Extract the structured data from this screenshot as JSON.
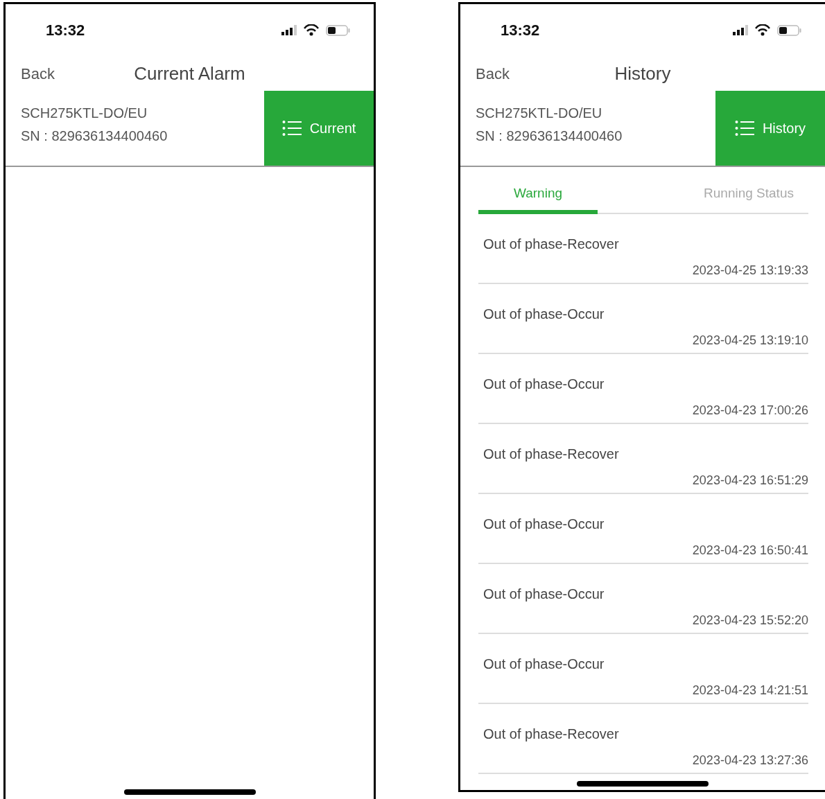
{
  "screens": [
    {
      "status_bar": {
        "time": "13:32"
      },
      "nav": {
        "back": "Back",
        "title": "Current Alarm"
      },
      "device": {
        "model": "SCH275KTL-DO/EU",
        "sn": "SN : 829636134400460"
      },
      "mode_button": {
        "label": "Current"
      }
    },
    {
      "status_bar": {
        "time": "13:32"
      },
      "nav": {
        "back": "Back",
        "title": "History"
      },
      "device": {
        "model": "SCH275KTL-DO/EU",
        "sn": "SN : 829636134400460"
      },
      "mode_button": {
        "label": "History"
      },
      "tabs": [
        {
          "label": "Warning",
          "selected": true
        },
        {
          "label": "Running Status",
          "selected": false
        }
      ],
      "entries": [
        {
          "event": "Out of phase-Recover",
          "time": "2023-04-25 13:19:33"
        },
        {
          "event": "Out of phase-Occur",
          "time": "2023-04-25 13:19:10"
        },
        {
          "event": "Out of phase-Occur",
          "time": "2023-04-23 17:00:26"
        },
        {
          "event": "Out of phase-Recover",
          "time": "2023-04-23 16:51:29"
        },
        {
          "event": "Out of phase-Occur",
          "time": "2023-04-23 16:50:41"
        },
        {
          "event": "Out of phase-Occur",
          "time": "2023-04-23 15:52:20"
        },
        {
          "event": "Out of phase-Occur",
          "time": "2023-04-23 14:21:51"
        },
        {
          "event": "Out of phase-Recover",
          "time": "2023-04-23 13:27:36"
        }
      ]
    }
  ]
}
